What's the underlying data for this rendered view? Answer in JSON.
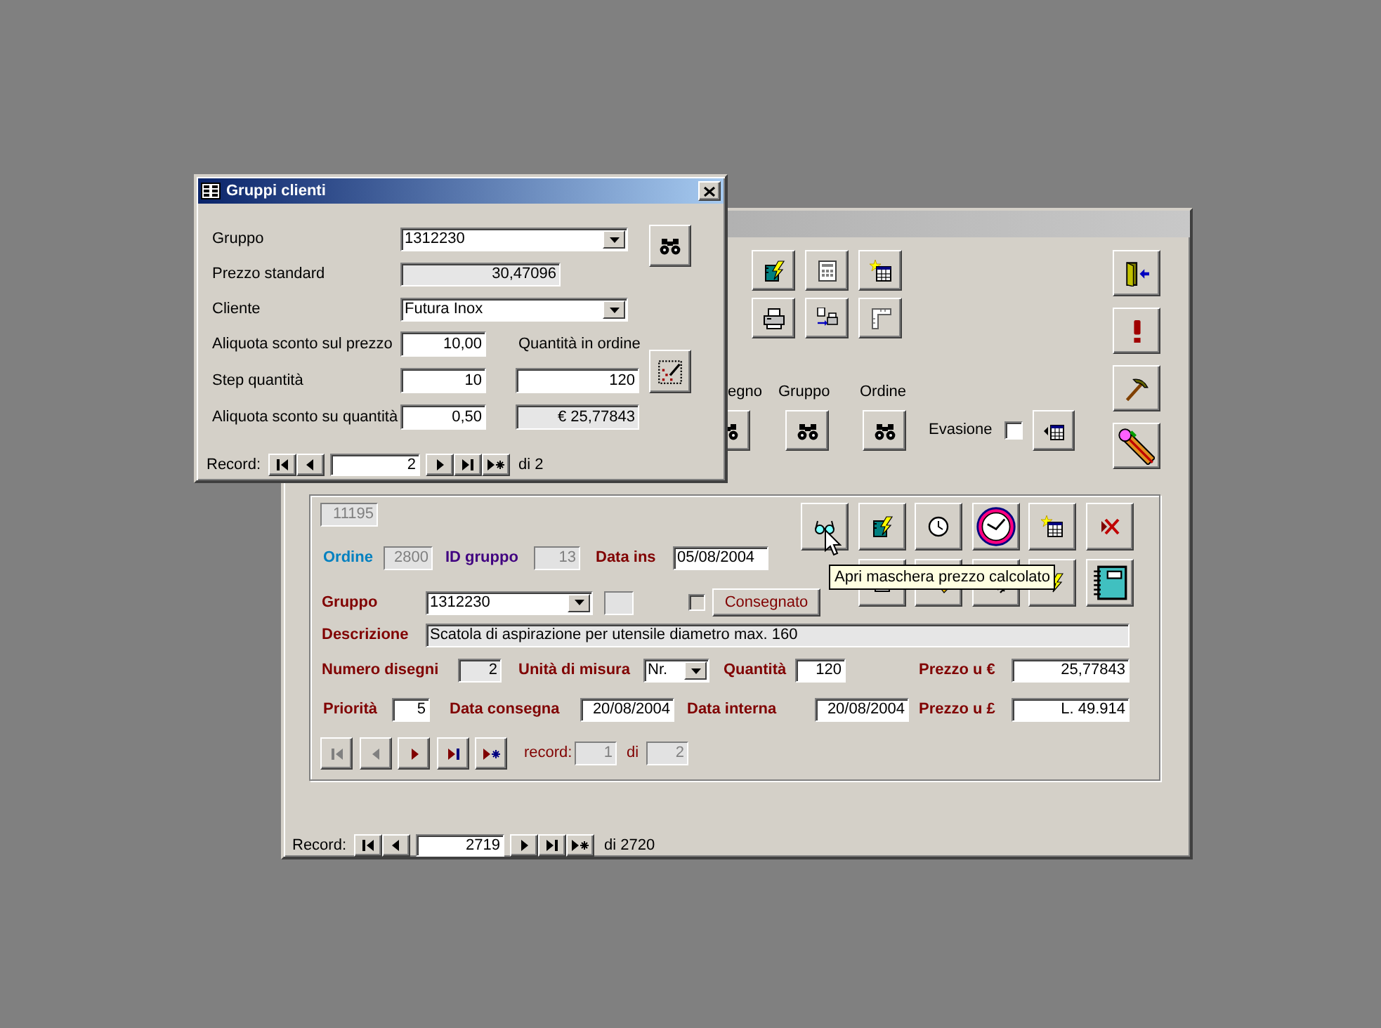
{
  "dialog": {
    "title": "Gruppi clienti",
    "rows": [
      {
        "label": "Gruppo",
        "field": {
          "kind": "combo",
          "value": "1312230"
        }
      },
      {
        "label": "Prezzo standard",
        "field": {
          "kind": "locked",
          "value": "30,47096"
        }
      },
      {
        "label": "Cliente",
        "field": {
          "kind": "combo",
          "value": "Futura Inox"
        }
      },
      {
        "label": "Aliquota sconto sul prezzo",
        "field": {
          "kind": "text",
          "value": "10,00"
        },
        "extra": {
          "kind": "label",
          "text": "Quantità in ordine"
        }
      },
      {
        "label": "Step quantità",
        "field": {
          "kind": "text",
          "value": "10"
        },
        "extra": {
          "kind": "text",
          "value": "120"
        }
      },
      {
        "label": "Aliquota sconto su quantità",
        "field": {
          "kind": "text",
          "value": "0,50"
        },
        "extra": {
          "kind": "locked",
          "value": "€ 25,77843"
        }
      }
    ],
    "record_nav": {
      "label": "Record:",
      "current": "2",
      "total": "di 2"
    }
  },
  "main_form": {
    "search": [
      {
        "label": "egno"
      },
      {
        "label": "Gruppo"
      },
      {
        "label": "Ordine"
      }
    ],
    "evasione": {
      "label": "Evasione",
      "checked": false
    },
    "subform": {
      "lines": [
        {
          "fields": [
            {
              "kind": "disabled",
              "value": "11195"
            }
          ]
        },
        {
          "fields": [
            {
              "kind": "disabled",
              "label": "Ordine",
              "color": "#0080c0",
              "value": "2800"
            },
            {
              "kind": "disabled",
              "label": "ID gruppo",
              "color": "#400080",
              "value": "13"
            },
            {
              "kind": "text",
              "label": "Data ins",
              "color": "#800000",
              "value": "05/08/2004"
            }
          ]
        },
        {
          "fields": [
            {
              "kind": "combo",
              "label": "Gruppo",
              "color": "#800000",
              "value": "1312230"
            },
            {
              "kind": "blank"
            },
            {
              "kind": "checkbox",
              "checked": false
            },
            {
              "kind": "button",
              "label": "Consegnato",
              "color": "#800000"
            }
          ]
        },
        {
          "fields": [
            {
              "kind": "locked",
              "label": "Descrizione",
              "color": "#800000",
              "value": "Scatola di aspirazione per utensile diametro max. 160"
            }
          ]
        },
        {
          "fields": [
            {
              "kind": "locked",
              "label": "Numero disegni",
              "color": "#800000",
              "value": "2"
            },
            {
              "kind": "combo",
              "label": "Unità di misura",
              "color": "#800000",
              "value": "Nr."
            },
            {
              "kind": "text",
              "label": "Quantità",
              "color": "#800000",
              "value": "120"
            },
            {
              "kind": "text",
              "label": "Prezzo u €",
              "color": "#800000",
              "value": "25,77843"
            }
          ]
        },
        {
          "fields": [
            {
              "kind": "text",
              "label": "Priorità",
              "color": "#800000",
              "value": "5"
            },
            {
              "kind": "text",
              "label": "Data consegna",
              "color": "#800000",
              "value": "20/08/2004"
            },
            {
              "kind": "text",
              "label": "Data interna",
              "color": "#800000",
              "value": "20/08/2004"
            },
            {
              "kind": "text",
              "label": "Prezzo u £",
              "color": "#800000",
              "value": "L. 49.914"
            }
          ]
        }
      ],
      "navigator": {
        "buttons": [
          {
            "kind": "first",
            "disabled": true
          },
          {
            "kind": "prev",
            "disabled": true
          },
          {
            "kind": "next",
            "disabled": false
          },
          {
            "kind": "last",
            "disabled": false
          },
          {
            "kind": "new",
            "disabled": false
          }
        ],
        "label": "record:",
        "current": "1",
        "of": "di",
        "total": "2"
      }
    },
    "tooltip": "Apri maschera prezzo calcolato",
    "record_nav": {
      "label": "Record:",
      "current": "2719",
      "total": "di 2720"
    }
  }
}
